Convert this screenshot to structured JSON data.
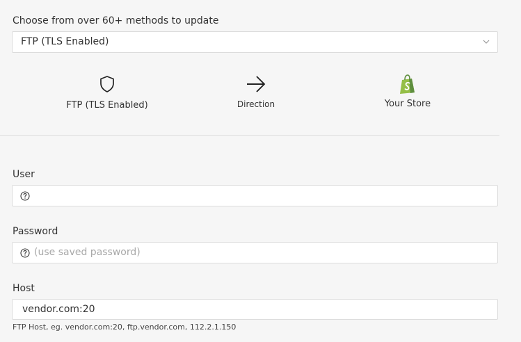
{
  "method": {
    "heading": "Choose from over 60+ methods to update",
    "selected": "FTP (TLS Enabled)"
  },
  "flow": {
    "source_label": "FTP (TLS Enabled)",
    "source_icon": "shield-icon",
    "direction_label": "Direction",
    "direction_icon": "arrow-right-icon",
    "target_label": "Your Store",
    "target_icon": "shopify-bag-icon",
    "target_icon_color": "#95bf47"
  },
  "form": {
    "user": {
      "label": "User",
      "value": "",
      "placeholder": ""
    },
    "password": {
      "label": "Password",
      "value": "",
      "placeholder": "(use saved password)"
    },
    "host": {
      "label": "Host",
      "value": "vendor.com:20",
      "hint": "FTP Host, eg. vendor.com:20, ftp.vendor.com, 112.2.1.150"
    }
  }
}
